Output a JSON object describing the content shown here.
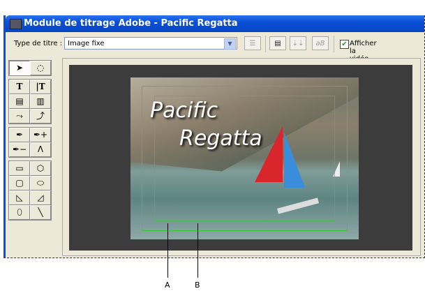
{
  "window": {
    "title": "Module de titrage Adobe - Pacific Regatta"
  },
  "toolbar": {
    "title_type_label": "Type de titre :",
    "title_type_value": "Image fixe",
    "show_video_label": "Afficher la vidéo",
    "show_video_checked": true
  },
  "canvas": {
    "title_line1": "Pacific",
    "title_line2": "Regatta"
  },
  "callouts": [
    "A",
    "B"
  ],
  "colors": {
    "titlebar": "#0a4fd6",
    "safe_area": "#33cc33",
    "canvas_bg": "#3c3c3c"
  }
}
